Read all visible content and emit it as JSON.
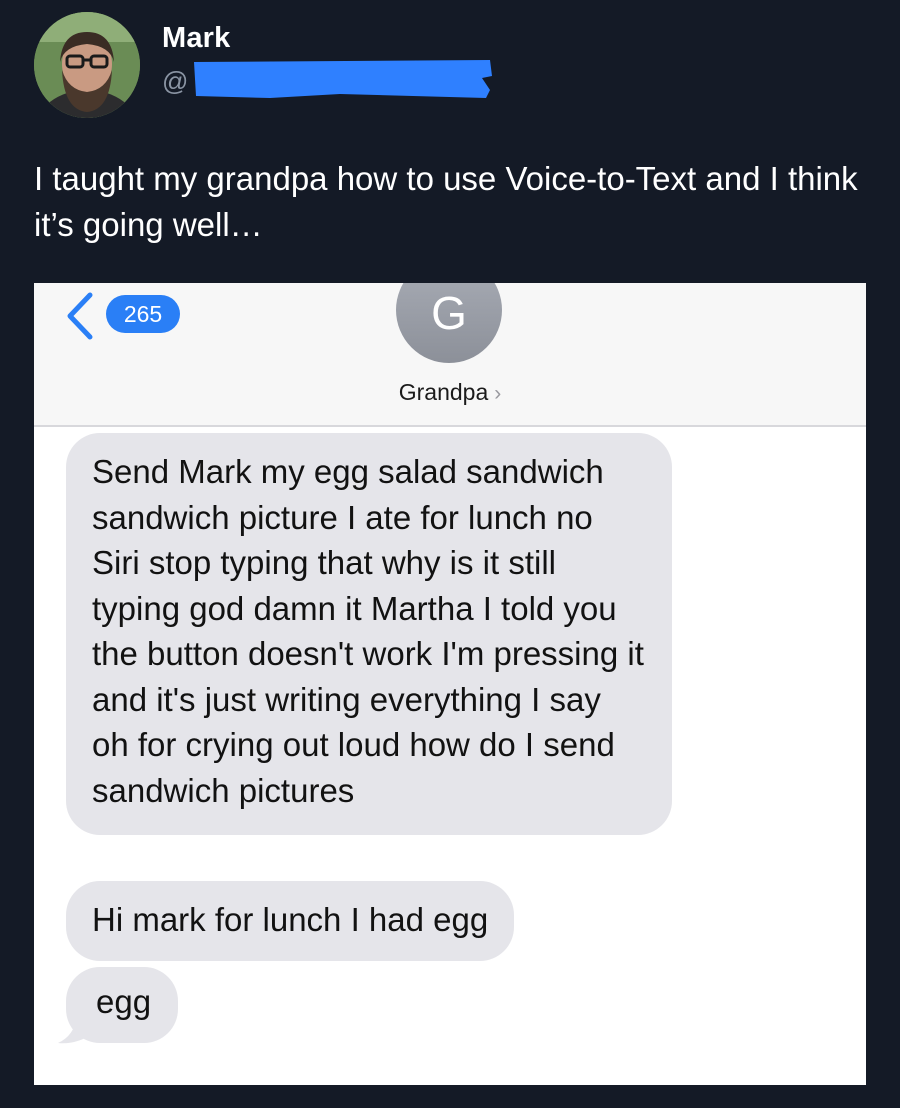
{
  "tweet": {
    "display_name": "Mark",
    "handle_prefix": "@",
    "avatar_icon": "profile-photo",
    "redaction_color": "#2f80ff",
    "text": "I taught my grandpa how to use Voice-to-Text and I think it’s going well…"
  },
  "imessage": {
    "back_icon": "chevron-left-icon",
    "unread_count": "265",
    "accent_color": "#2a7ff6",
    "contact_initial": "G",
    "contact_name": "Grandpa",
    "contact_chevron": "›",
    "bubble_color": "#e5e5ea",
    "messages": [
      {
        "text": "Send Mark my egg salad sandwich sandwich picture I ate for lunch no Siri stop typing that why is it still typing god damn it Martha I told you the button doesn't work I'm pressing it and it's just writing everything I say oh for crying out loud how do I send sandwich pictures"
      },
      {
        "text": "Hi mark for lunch I had egg"
      },
      {
        "text": "egg"
      }
    ]
  }
}
